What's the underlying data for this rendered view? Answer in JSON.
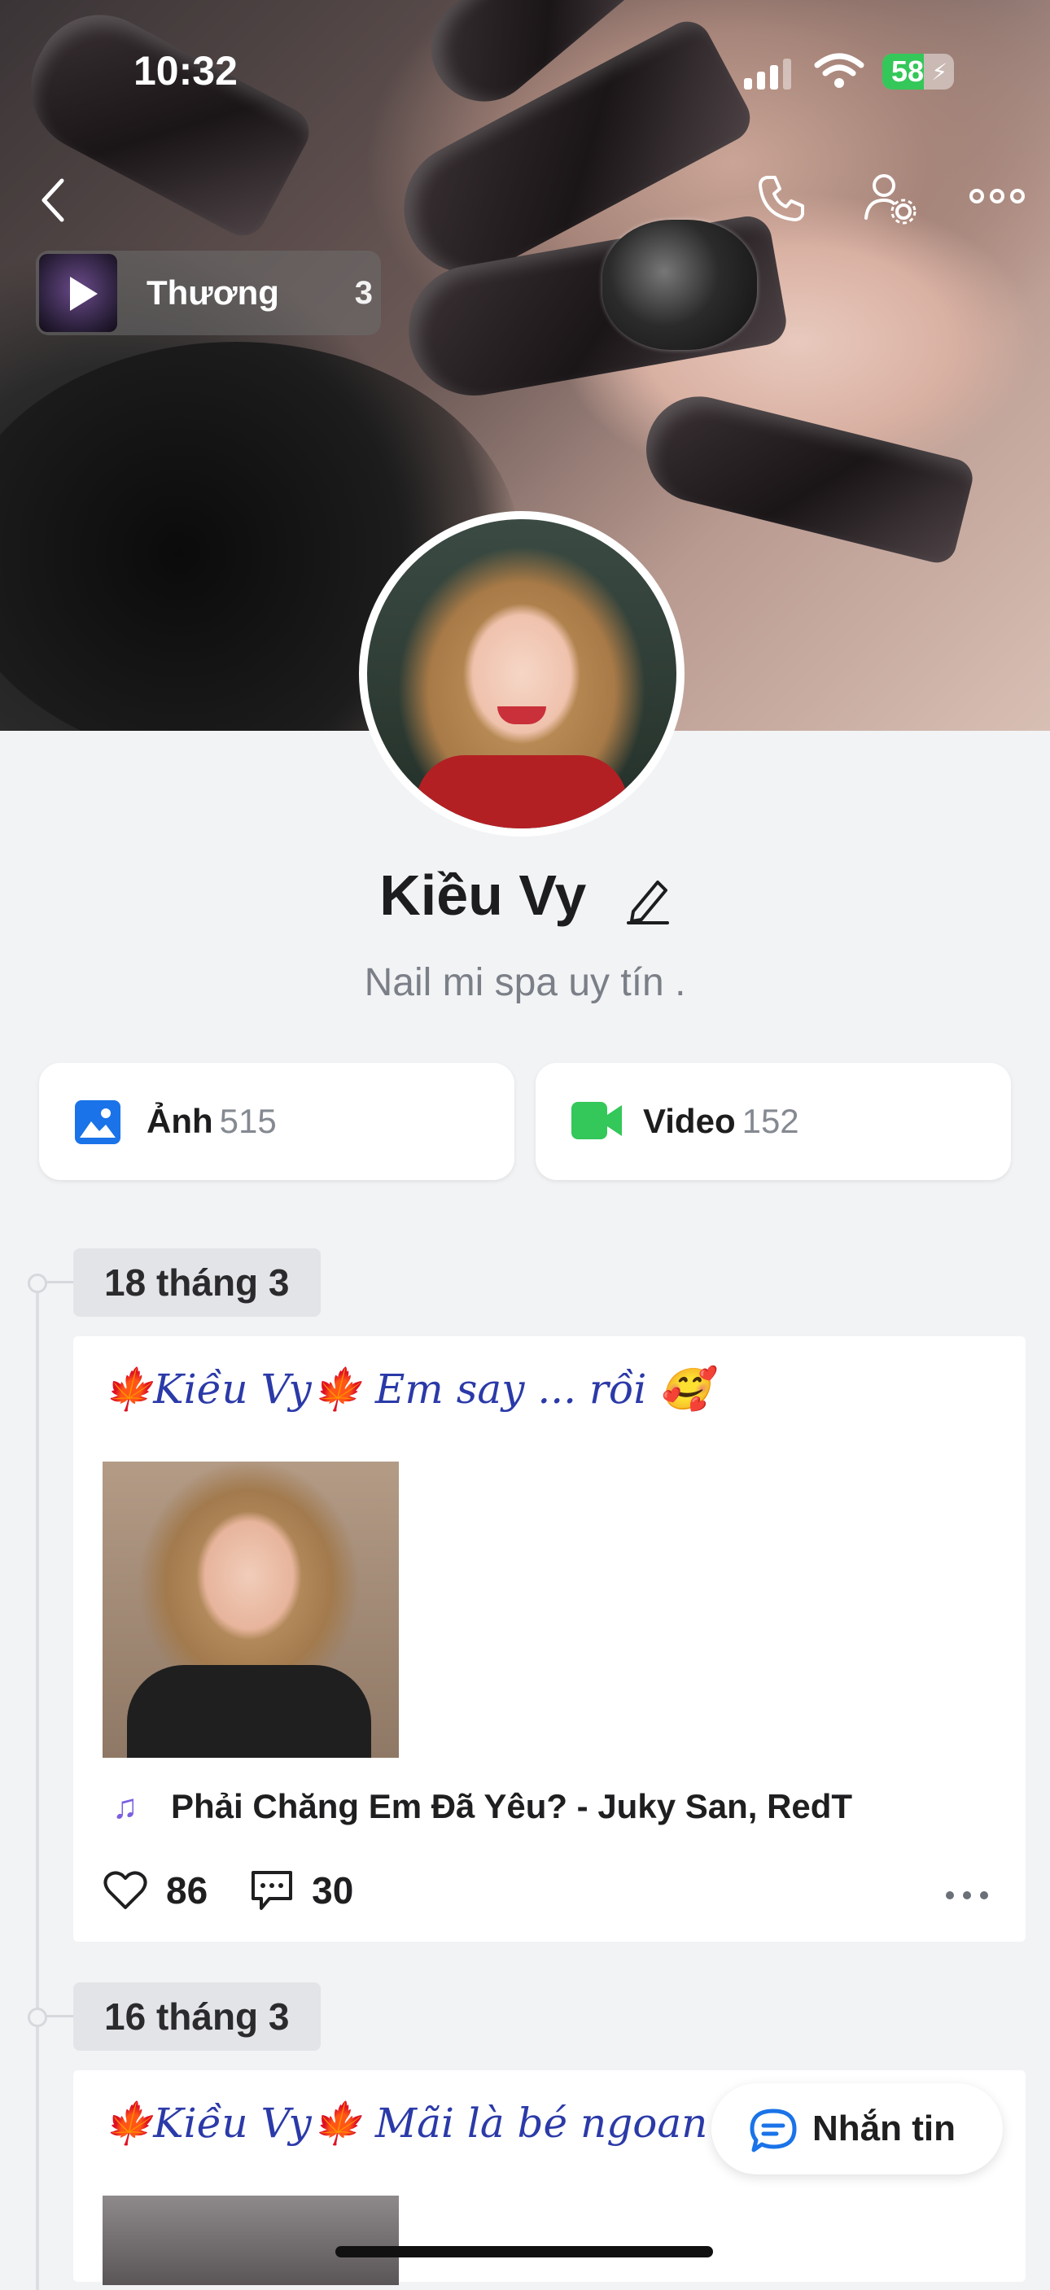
{
  "status_bar": {
    "time": "10:32",
    "battery": "58",
    "signal_icon": "cellular-signal-icon",
    "wifi_icon": "wifi-icon",
    "charging_icon": "bolt-icon"
  },
  "nav": {
    "back_icon": "chevron-left-icon",
    "call_icon": "phone-icon",
    "settings_icon": "user-settings-icon",
    "more_icon": "ellipsis-icon"
  },
  "playlist": {
    "name": "Thương",
    "count": "3"
  },
  "profile": {
    "name": "Kiều Vy",
    "bio": "Nail mi spa uy tín ."
  },
  "media": [
    {
      "label": "Ảnh",
      "count": "515",
      "icon": "photo-icon",
      "color": "#1a73e8"
    },
    {
      "label": "Video",
      "count": "152",
      "icon": "video-icon",
      "color": "#34c759"
    }
  ],
  "posts": [
    {
      "date": "18 tháng 3",
      "caption": "🍁Kiều Vy🍁 Em say ... rồi 🥰",
      "music": "Phải Chăng Em Đã Yêu? - Juky San, RedT",
      "likes": "86",
      "comments": "30"
    },
    {
      "date": "16 tháng 3",
      "caption": "🍁Kiều Vy🍁 Mãi là bé ngoan xi"
    }
  ],
  "message_button": {
    "label": "Nhắn tin",
    "icon": "chat-bubble-icon"
  },
  "colors": {
    "accent": "#1a73e8",
    "music": "#7b5fe0",
    "caption": "#2b3aa8"
  }
}
